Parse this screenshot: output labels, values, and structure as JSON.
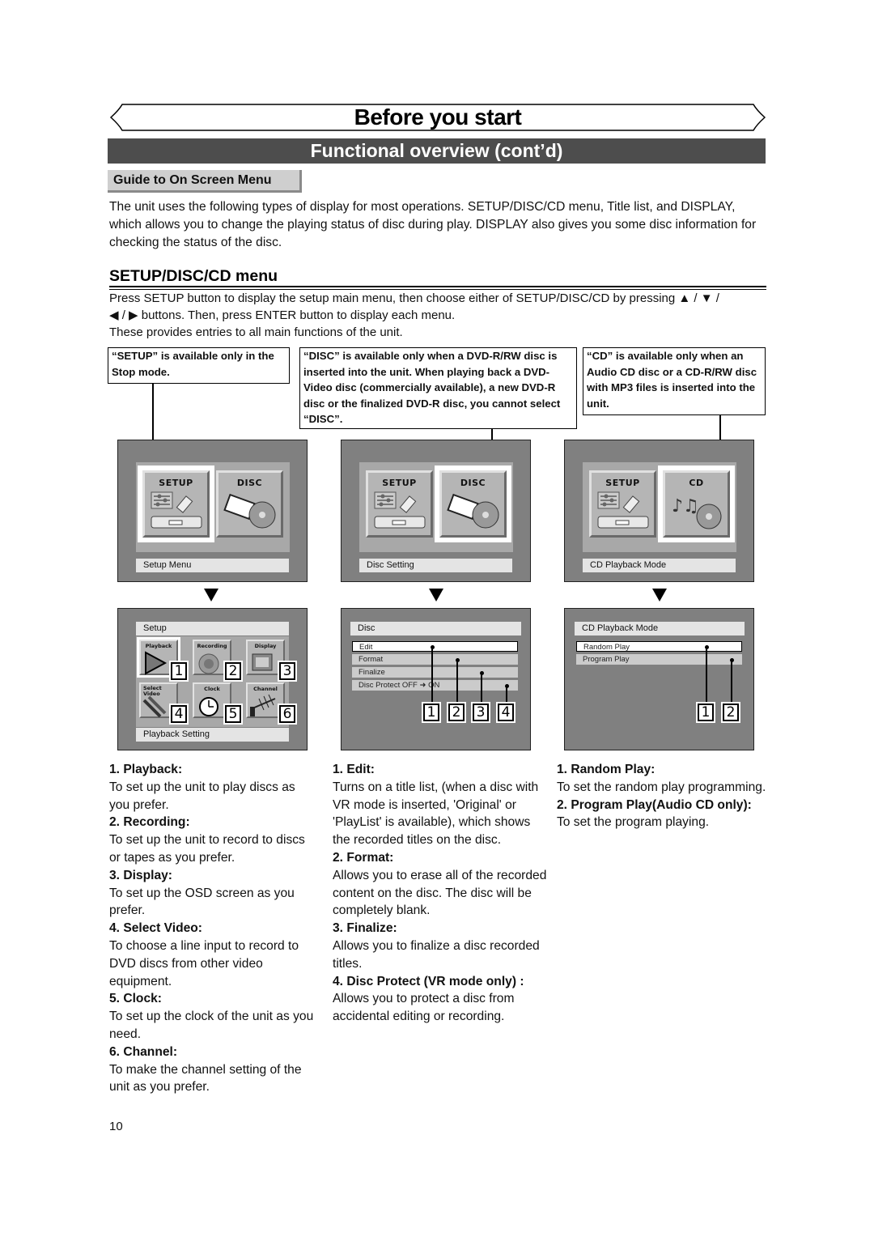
{
  "header": {
    "title": "Before you start",
    "section": "Functional overview (cont’d)",
    "guide_tab": "Guide to On Screen Menu"
  },
  "intro": "The unit uses the following types of display for most operations. SETUP/DISC/CD menu, Title list, and DISPLAY, which allows you to change the playing status of disc during play. DISPLAY also gives you some disc information for checking the status of the disc.",
  "setup_section": {
    "heading": "SETUP/DISC/CD menu",
    "line1": "Press SETUP button to display the setup main menu, then choose either of SETUP/DISC/CD by pressing ▲ / ▼ /",
    "line2": "◀ / ▶ buttons. Then, press ENTER button to display each menu.",
    "line3": "These provides entries to all main functions of the unit."
  },
  "notes": {
    "setup": "“SETUP” is available only in the Stop mode.",
    "disc": "“DISC” is available only when a DVD-R/RW disc is inserted into the unit. When playing back a DVD-Video disc (commercially available), a new DVD-R disc or the finalized DVD-R disc, you cannot select “DISC”.",
    "cd": "“CD” is available only when an Audio CD disc or a CD-R/RW disc with MP3 files is inserted into the unit."
  },
  "top_screens": [
    {
      "left_label": "SETUP",
      "right_label": "DISC",
      "selected": "left",
      "status": "Setup Menu"
    },
    {
      "left_label": "SETUP",
      "right_label": "DISC",
      "selected": "right",
      "status": "Disc Setting"
    },
    {
      "left_label": "SETUP",
      "right_label": "CD",
      "selected": "right",
      "status": "CD Playback Mode"
    }
  ],
  "setup_screen": {
    "header": "Setup",
    "tiles": [
      {
        "label": "Playback",
        "num": "1",
        "icon": "play-icon"
      },
      {
        "label": "Recording",
        "num": "2",
        "icon": "record-icon"
      },
      {
        "label": "Display",
        "num": "3",
        "icon": "display-icon"
      },
      {
        "label": "Select Video",
        "num": "4",
        "icon": "cable-icon"
      },
      {
        "label": "Clock",
        "num": "5",
        "icon": "clock-icon"
      },
      {
        "label": "Channel",
        "num": "6",
        "icon": "antenna-icon"
      }
    ],
    "status": "Playback Setting"
  },
  "disc_screen": {
    "header": "Disc",
    "items": [
      "Edit",
      "Format",
      "Finalize",
      "Disc Protect OFF ➜ ON"
    ],
    "nums": [
      "1",
      "2",
      "3",
      "4"
    ]
  },
  "cd_screen": {
    "header": "CD Playback Mode",
    "items": [
      "Random Play",
      "Program Play"
    ],
    "nums": [
      "1",
      "2"
    ]
  },
  "descriptions": {
    "col1": [
      {
        "head": "1. Playback:",
        "text": "To set up the unit to play discs as you prefer."
      },
      {
        "head": "2. Recording:",
        "text": "To set up the unit to record to discs or tapes as you prefer."
      },
      {
        "head": "3. Display:",
        "text": "To set up the OSD screen as you prefer."
      },
      {
        "head": "4. Select Video:",
        "text": "To choose a line input to record to DVD discs from other video equipment."
      },
      {
        "head": "5. Clock:",
        "text": "To set up the clock of the unit as you need."
      },
      {
        "head": "6. Channel:",
        "text": "To make the channel setting of the unit as you prefer."
      }
    ],
    "col2": [
      {
        "head": "1. Edit:",
        "text": "Turns on a title list, (when a disc with VR mode is inserted, 'Original' or 'PlayList' is available), which shows the recorded titles on the disc."
      },
      {
        "head": "2. Format:",
        "text": "Allows you to erase all of the recorded content on the disc. The disc will be completely blank."
      },
      {
        "head": "3. Finalize:",
        "text": "Allows you to finalize a disc recorded titles."
      },
      {
        "head": "4. Disc Protect (VR mode only) :",
        "text": "Allows you to protect a disc from accidental editing or recording."
      }
    ],
    "col3": [
      {
        "head": "1. Random Play:",
        "text": "To set the random play programming."
      },
      {
        "head": "2. Program Play(Audio CD only):",
        "text": "To set the program playing."
      }
    ]
  },
  "page_number": "10"
}
